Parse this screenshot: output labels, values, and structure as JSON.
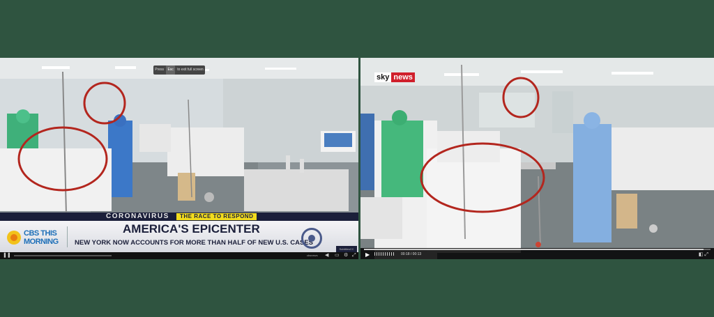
{
  "left_panel": {
    "esc_hint": {
      "prefix": "Press",
      "key": "Esc",
      "suffix": "to exit full screen"
    },
    "ticker": {
      "topic": "CORONAVIRUS",
      "tag": "THE RACE TO RESPOND"
    },
    "show_logo": {
      "line1": "CBS THIS",
      "line2": "MORNING"
    },
    "headline": "AMERICA'S EPICENTER",
    "subheadline": "NEW YORK NOW ACCOUNTS FOR MORE THAN HALF OF NEW U.S. CASES",
    "cc_badge": "SubtitlesCC",
    "player": {
      "site_label": "cbsnews"
    }
  },
  "right_panel": {
    "logo": {
      "part1": "sky",
      "part2": "news"
    },
    "player": {
      "time": "00:18 / 00:13",
      "progress": 0.98
    }
  },
  "colors": {
    "background": "#2f5440",
    "cbs_blue": "#1b1f3a",
    "race_yellow": "#f2dc1e",
    "sky_red": "#d01f2b",
    "annotation_red": "#b3261e"
  }
}
